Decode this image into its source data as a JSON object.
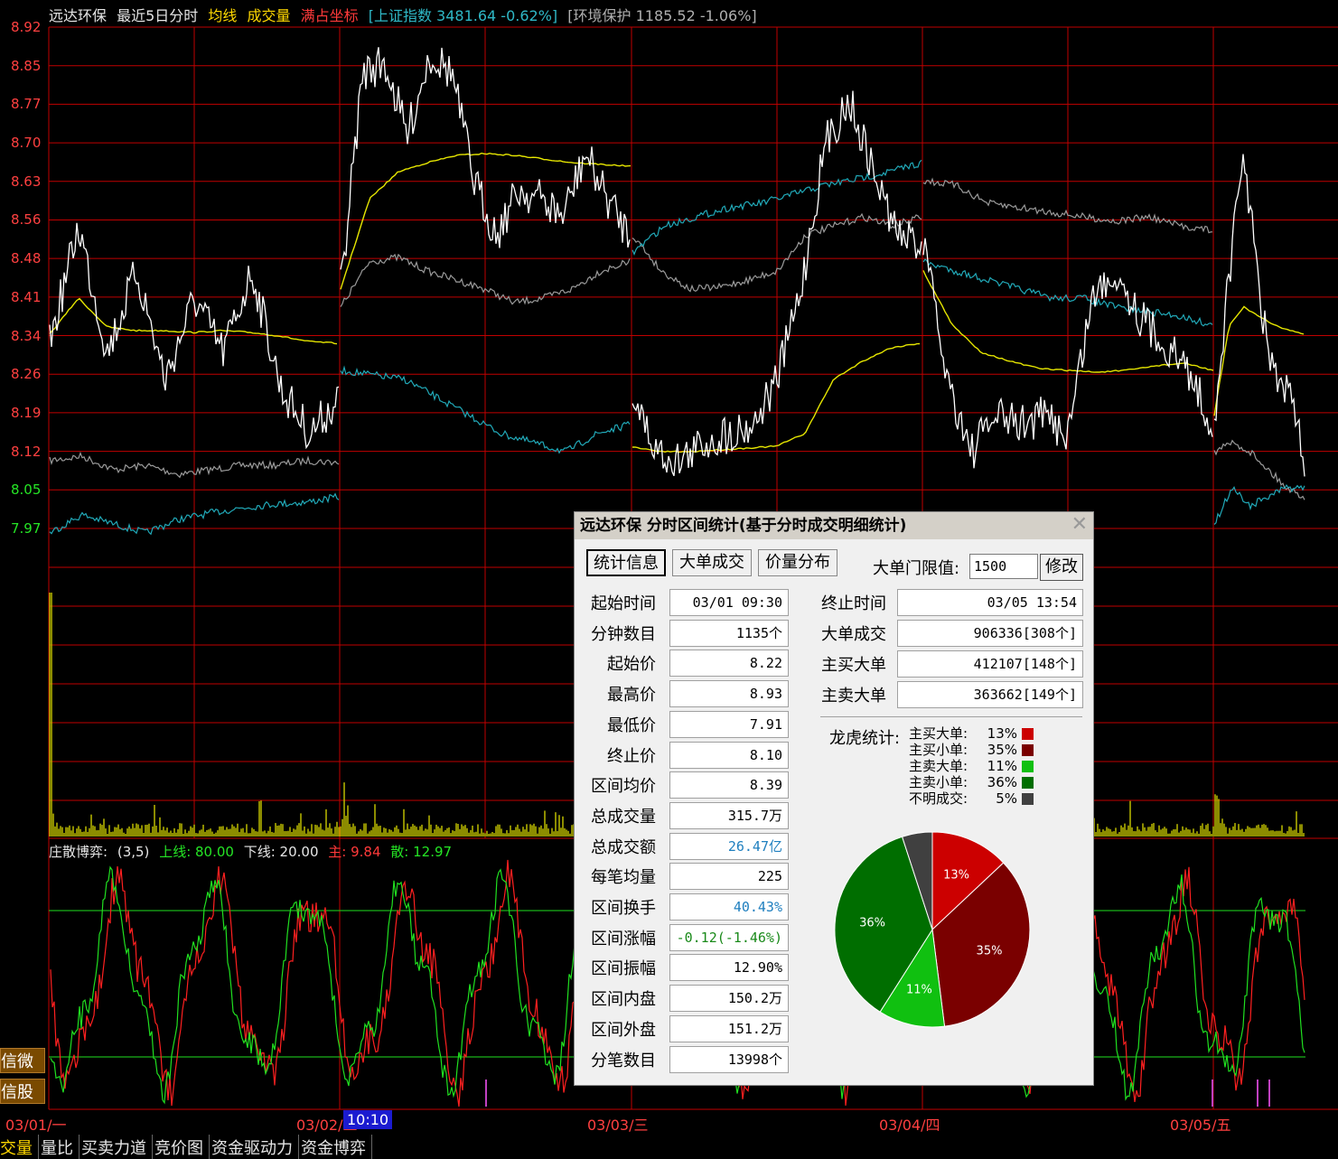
{
  "header": {
    "stock": "远达环保",
    "mode": "最近5日分时",
    "ma_label": "均线",
    "vol_label": "成交量",
    "coord_label": "满占坐标",
    "index_label": "[上证指数 3481.64 -0.62%]",
    "sector_label": "[环境保护 1185.52 -1.06%]"
  },
  "y_axis": [
    "8.92",
    "8.85",
    "8.77",
    "8.70",
    "8.63",
    "8.56",
    "8.48",
    "8.41",
    "8.34",
    "8.26",
    "8.19",
    "8.12",
    "8.05",
    "7.97"
  ],
  "indicator": {
    "name": "庄散博弈:",
    "params": "(3,5)",
    "upper": "上线: 80.00",
    "lower": "下线: 20.00",
    "main": "主: 9.84",
    "retail": "散: 12.97"
  },
  "x_axis": [
    "03/01/一",
    "03/02/二",
    "03/03/三",
    "03/04/四",
    "03/05/五"
  ],
  "time_highlight": "10:10",
  "side_buttons": [
    "信微信",
    "信股搜"
  ],
  "bottom_tabs": [
    "交量",
    "量比",
    "买卖力道",
    "竞价图",
    "资金驱动力",
    "资金博弈"
  ],
  "colors": {
    "price": "#ffffff",
    "avg": "#e6e600",
    "index": "#21a9b8",
    "sector": "#9a9a9a",
    "grid": "#c00000",
    "volume": "#c8c800",
    "main_line": "#ff2020",
    "retail_line": "#20e020"
  },
  "dialog": {
    "title": "远达环保 分时区间统计(基于分时成交明细统计)",
    "tabs": [
      "统计信息",
      "大单成交",
      "价量分布"
    ],
    "threshold_label": "大单门限值:",
    "threshold_value": "1500",
    "modify": "修改",
    "left_stats": [
      {
        "label": "起始时间",
        "value": "03/01 09:30"
      },
      {
        "label": "分钟数目",
        "value": "1135个"
      },
      {
        "label": "起始价",
        "value": "8.22"
      },
      {
        "label": "最高价",
        "value": "8.93"
      },
      {
        "label": "最低价",
        "value": "7.91"
      },
      {
        "label": "终止价",
        "value": "8.10"
      },
      {
        "label": "区间均价",
        "value": "8.39"
      },
      {
        "label": "总成交量",
        "value": "315.7万"
      },
      {
        "label": "总成交额",
        "value": "26.47亿"
      },
      {
        "label": "每笔均量",
        "value": "225"
      },
      {
        "label": "区间换手",
        "value": "40.43%"
      },
      {
        "label": "区间涨幅",
        "value": "-0.12(-1.46%)"
      },
      {
        "label": "区间振幅",
        "value": "12.90%"
      },
      {
        "label": "区间内盘",
        "value": "150.2万"
      },
      {
        "label": "区间外盘",
        "value": "151.2万"
      },
      {
        "label": "分笔数目",
        "value": "13998个"
      }
    ],
    "right_stats": [
      {
        "label": "终止时间",
        "value": "03/05 13:54"
      },
      {
        "label": "大单成交",
        "value": "906336[308个]"
      },
      {
        "label": "主买大单",
        "value": "412107[148个]"
      },
      {
        "label": "主卖大单",
        "value": "363662[149个]"
      }
    ],
    "dragon_label": "龙虎统计:",
    "pie": [
      {
        "label": "主买大单:",
        "pct": "13%",
        "value": 13,
        "color": "#cc0000"
      },
      {
        "label": "主买小单:",
        "pct": "35%",
        "value": 35,
        "color": "#7a0000"
      },
      {
        "label": "主卖大单:",
        "pct": "11%",
        "value": 11,
        "color": "#10c010"
      },
      {
        "label": "主卖小单:",
        "pct": "36%",
        "value": 36,
        "color": "#006e00"
      },
      {
        "label": "不明成交:",
        "pct": "5%",
        "value": 5,
        "color": "#404040"
      }
    ]
  }
}
